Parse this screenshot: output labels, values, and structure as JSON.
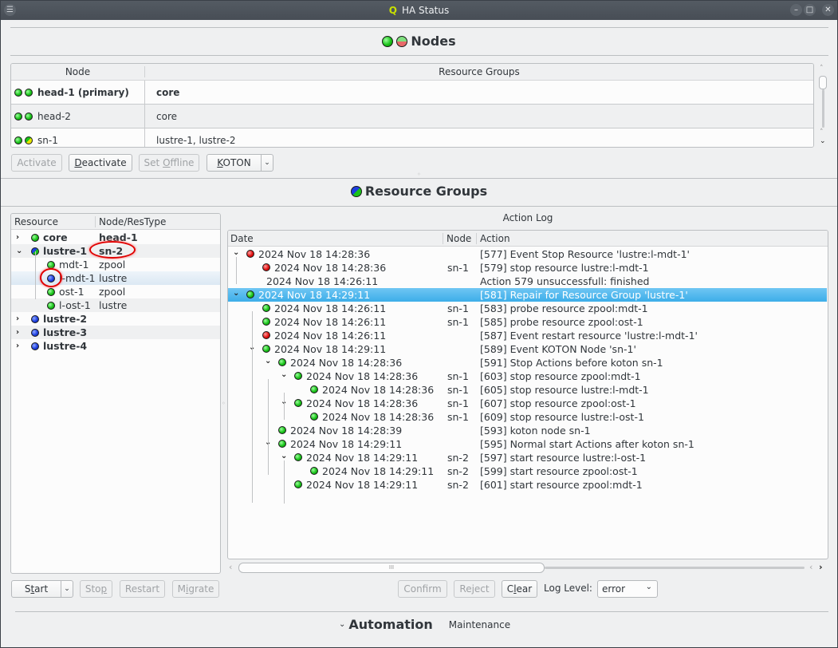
{
  "window": {
    "title": "HA Status",
    "app_icon": "Q",
    "buttons": [
      "minimize",
      "maximize",
      "close"
    ]
  },
  "nodes_section": {
    "title": "Nodes",
    "columns": [
      "Node",
      "Resource Groups"
    ],
    "rows": [
      {
        "status": [
          "green",
          "green"
        ],
        "node": "head-1 (primary)",
        "groups": "core",
        "bold": true
      },
      {
        "status": [
          "green",
          "green"
        ],
        "node": "head-2",
        "groups": "core",
        "bold": false
      },
      {
        "status": [
          "green",
          "yellow-green"
        ],
        "node": "sn-1",
        "groups": "lustre-1, lustre-2",
        "bold": false
      }
    ],
    "buttons": {
      "activate": "Activate",
      "deactivate": "Deactivate",
      "set_offline": "Set Offline",
      "koton": "KOTON"
    }
  },
  "resource_groups_section": {
    "title": "Resource Groups",
    "tree": {
      "columns": [
        "Resource",
        "Node/ResType"
      ],
      "rows": [
        {
          "name": "core",
          "type": "head-1",
          "status": "green",
          "level": 0,
          "expander": "collapsed",
          "bold": true
        },
        {
          "name": "lustre-1",
          "type": "sn-2",
          "status": "blue-green",
          "level": 0,
          "expander": "expanded",
          "bold": true,
          "highlighted": true
        },
        {
          "name": "mdt-1",
          "type": "zpool",
          "status": "green",
          "level": 1
        },
        {
          "name": "l-mdt-1",
          "type": "lustre",
          "status": "blue",
          "level": 1,
          "selected": true,
          "highlighted": true
        },
        {
          "name": "ost-1",
          "type": "zpool",
          "status": "green",
          "level": 1
        },
        {
          "name": "l-ost-1",
          "type": "lustre",
          "status": "green",
          "level": 1
        },
        {
          "name": "lustre-2",
          "type": "",
          "status": "blue",
          "level": 0,
          "expander": "collapsed",
          "bold": true
        },
        {
          "name": "lustre-3",
          "type": "",
          "status": "blue",
          "level": 0,
          "expander": "collapsed",
          "bold": true
        },
        {
          "name": "lustre-4",
          "type": "",
          "status": "blue",
          "level": 0,
          "expander": "collapsed",
          "bold": true
        }
      ]
    },
    "resource_buttons": {
      "start": "Start",
      "stop": "Stop",
      "restart": "Restart",
      "migrate": "Migrate"
    },
    "action_log": {
      "title": "Action Log",
      "columns": [
        "Date",
        "Node",
        "Action"
      ],
      "rows": [
        {
          "level": 0,
          "expander": true,
          "status": "red",
          "date": "2024 Nov 18 14:28:36",
          "node": "",
          "action": "[577] Event Stop Resource 'lustre:l-mdt-1'"
        },
        {
          "level": 1,
          "status": "red",
          "date": "2024 Nov 18 14:28:36",
          "node": "sn-1",
          "action": "[579] stop resource lustre:l-mdt-1"
        },
        {
          "level": 1,
          "status": "",
          "date": "2024 Nov 18 14:26:11",
          "node": "",
          "action": "Action 579 unsuccessfull: finished"
        },
        {
          "level": 0,
          "expander": true,
          "status": "green",
          "date": "2024 Nov 18 14:29:11",
          "node": "",
          "action": "[581] Repair for Resource Group 'lustre-1'",
          "selected": true
        },
        {
          "level": 1,
          "status": "green",
          "date": "2024 Nov 18 14:26:11",
          "node": "sn-1",
          "action": "[583] probe resource zpool:mdt-1"
        },
        {
          "level": 1,
          "status": "green",
          "date": "2024 Nov 18 14:26:11",
          "node": "sn-1",
          "action": "[585] probe resource zpool:ost-1"
        },
        {
          "level": 1,
          "status": "red",
          "date": "2024 Nov 18 14:26:11",
          "node": "",
          "action": "[587] Event restart resource 'lustre:l-mdt-1'"
        },
        {
          "level": 1,
          "expander": true,
          "status": "green",
          "date": "2024 Nov 18 14:29:11",
          "node": "",
          "action": "[589] Event KOTON Node 'sn-1'"
        },
        {
          "level": 2,
          "expander": true,
          "status": "green",
          "date": "2024 Nov 18 14:28:36",
          "node": "",
          "action": "[591] Stop Actions before koton sn-1"
        },
        {
          "level": 3,
          "expander": true,
          "status": "green",
          "date": "2024 Nov 18 14:28:36",
          "node": "sn-1",
          "action": "[603] stop resource zpool:mdt-1"
        },
        {
          "level": 4,
          "status": "green",
          "date": "2024 Nov 18 14:28:36",
          "node": "sn-1",
          "action": "[605] stop resource lustre:l-mdt-1"
        },
        {
          "level": 3,
          "expander": true,
          "status": "green",
          "date": "2024 Nov 18 14:28:36",
          "node": "sn-1",
          "action": "[607] stop resource zpool:ost-1"
        },
        {
          "level": 4,
          "status": "green",
          "date": "2024 Nov 18 14:28:36",
          "node": "sn-1",
          "action": "[609] stop resource lustre:l-ost-1"
        },
        {
          "level": 2,
          "status": "green",
          "date": "2024 Nov 18 14:28:39",
          "node": "",
          "action": "[593] koton node sn-1"
        },
        {
          "level": 2,
          "expander": true,
          "status": "green",
          "date": "2024 Nov 18 14:29:11",
          "node": "",
          "action": "[595] Normal start Actions after koton sn-1"
        },
        {
          "level": 3,
          "expander": true,
          "status": "green",
          "date": "2024 Nov 18 14:29:11",
          "node": "sn-2",
          "action": "[597] start resource lustre:l-ost-1"
        },
        {
          "level": 4,
          "status": "green",
          "date": "2024 Nov 18 14:29:11",
          "node": "sn-2",
          "action": "[599] start resource zpool:ost-1"
        },
        {
          "level": 3,
          "status": "green",
          "date": "2024 Nov 18 14:29:11",
          "node": "sn-2",
          "action": "[601] start resource zpool:mdt-1"
        }
      ],
      "buttons": {
        "confirm": "Confirm",
        "reject": "Reject",
        "clear": "Clear"
      },
      "log_level_label": "Log Level:",
      "log_level_value": "error"
    }
  },
  "automation_section": {
    "title": "Automation",
    "subtitle": "Maintenance"
  }
}
